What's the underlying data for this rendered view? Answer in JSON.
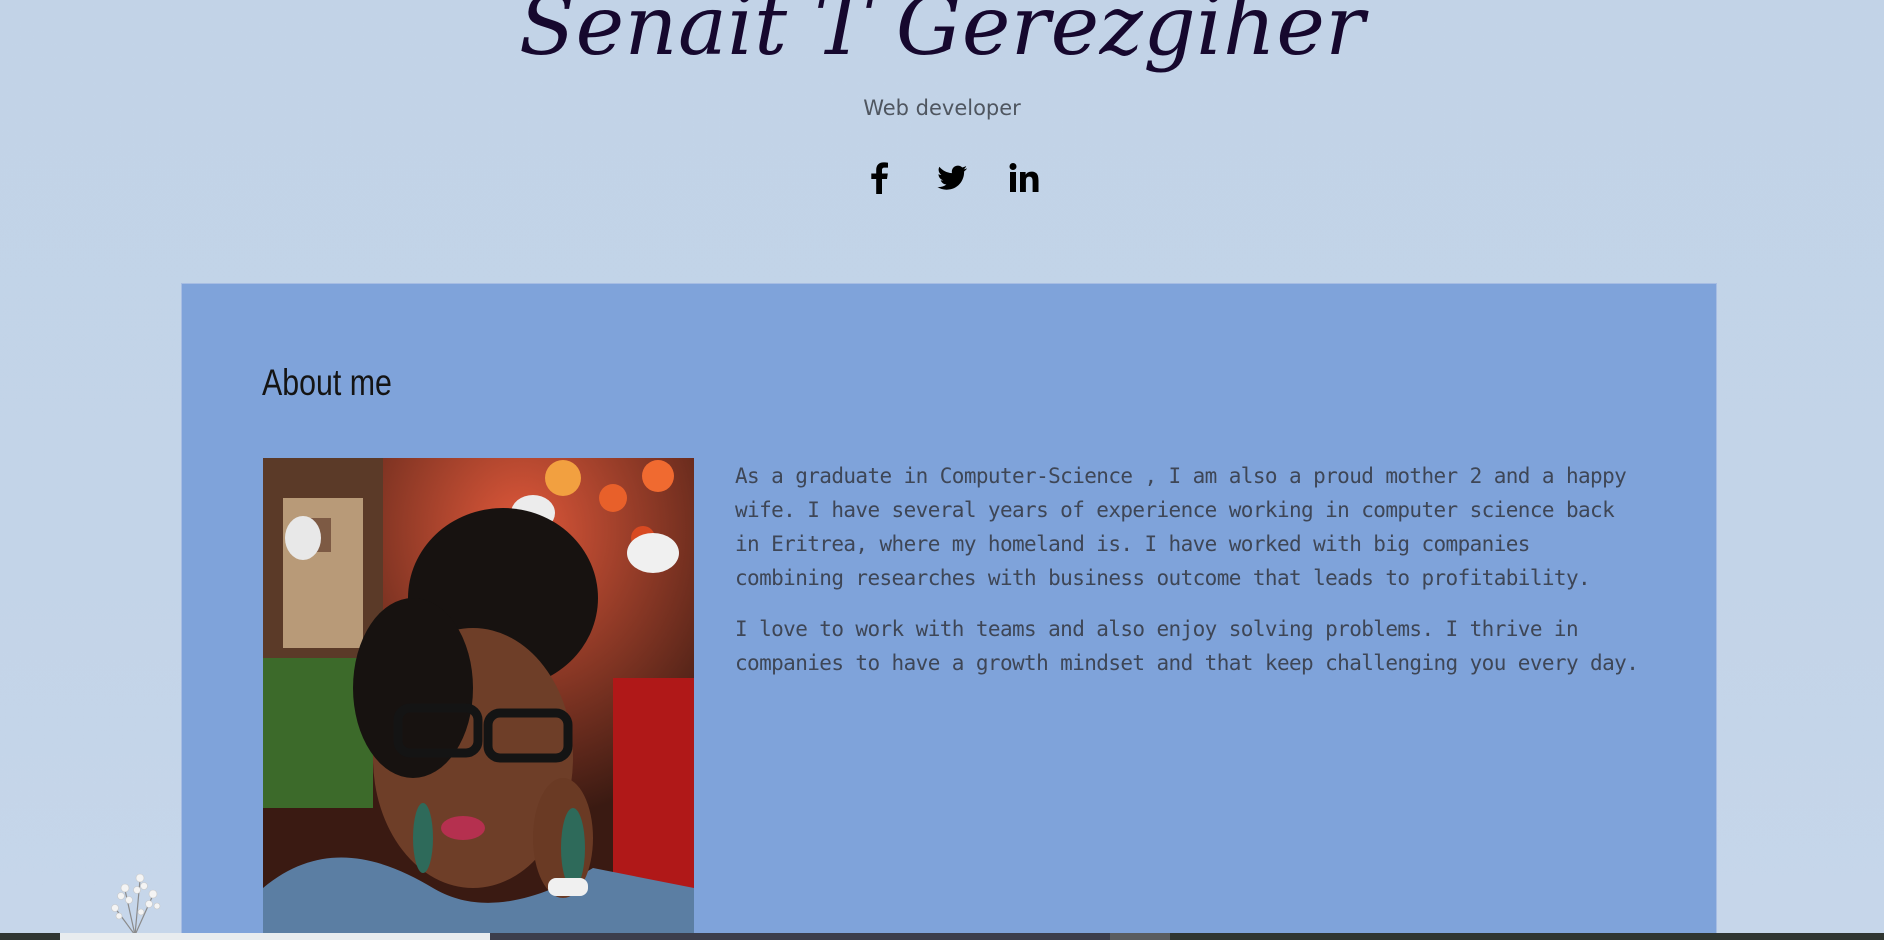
{
  "header": {
    "name": "Senait T Gerezgiher",
    "role": "Web developer"
  },
  "social": [
    {
      "network": "Facebook",
      "icon": "facebook-icon",
      "glyph": "f"
    },
    {
      "network": "Twitter",
      "icon": "twitter-icon"
    },
    {
      "network": "LinkedIn",
      "icon": "linkedin-icon",
      "glyph": "in"
    }
  ],
  "about": {
    "heading": "About me",
    "photo_icon": "profile-photo",
    "paragraphs": [
      "As a graduate in Computer-Science , I am also a proud mother 2 and a happy wife. I have several years of experience working in computer science back in Eritrea, where my homeland is. I have worked with big companies combining researches with business outcome that leads to profitability.",
      "I love to work with teams and also enjoy solving problems. I thrive in companies to have a growth mindset and that keep challenging you every day."
    ]
  },
  "colors": {
    "page_background": "#c2d3e7",
    "panel_background": "#7fa3da",
    "title_color": "#16082e",
    "body_text": "#3e4656"
  }
}
